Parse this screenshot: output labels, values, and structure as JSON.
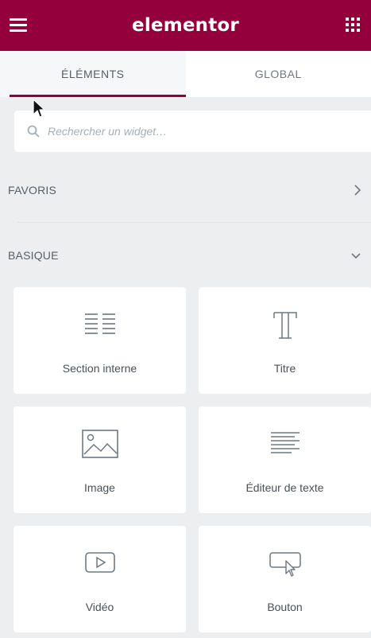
{
  "header": {
    "logo": "elementor",
    "menu_icon": "hamburger-icon",
    "apps_icon": "grid-icon",
    "brand_color": "#93003c"
  },
  "tabs": [
    {
      "label": "ÉLÉMENTS",
      "active": true
    },
    {
      "label": "GLOBAL",
      "active": false
    }
  ],
  "search": {
    "placeholder": "Rechercher un widget…",
    "icon": "search-icon"
  },
  "categories": {
    "favoris": {
      "label": "FAVORIS",
      "state": "collapsed",
      "icon": "chevron-right-icon"
    },
    "basique": {
      "label": "BASIQUE",
      "state": "expanded",
      "icon": "chevron-down-icon"
    }
  },
  "widgets": [
    {
      "label": "Section interne",
      "icon": "inner-section-icon"
    },
    {
      "label": "Titre",
      "icon": "heading-icon"
    },
    {
      "label": "Image",
      "icon": "image-icon"
    },
    {
      "label": "Éditeur de texte",
      "icon": "text-editor-icon"
    },
    {
      "label": "Vidéo",
      "icon": "video-icon"
    },
    {
      "label": "Bouton",
      "icon": "button-icon"
    }
  ]
}
